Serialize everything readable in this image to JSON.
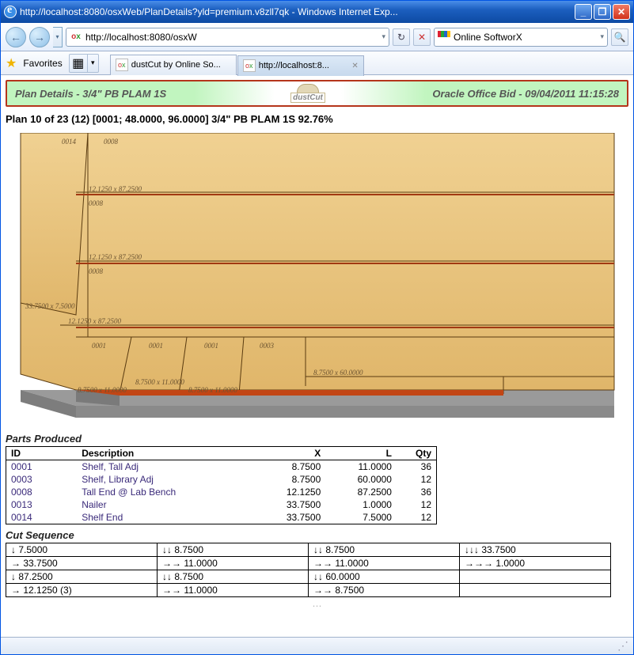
{
  "window": {
    "title": "http://localhost:8080/osxWeb/PlanDetails?yld=premium.v8zll7qk - Windows Internet Exp...",
    "buttons": {
      "min": "_",
      "max": "❐",
      "close": "✕"
    }
  },
  "nav": {
    "back_arrow": "←",
    "fwd_arrow": "→",
    "dropdown_arrow": "▾",
    "url": "http://localhost:8080/osxW",
    "refresh": "↻",
    "stop": "✕",
    "search_placeholder": "",
    "search_value": "Online SoftworX",
    "search_dropdown": "▾",
    "search_go": "🔍"
  },
  "favbar": {
    "label": "Favorites",
    "quick_dropdown": "▾"
  },
  "tabs": [
    {
      "label": "dustCut by Online So...",
      "active": false
    },
    {
      "label": "http://localhost:8...",
      "active": true
    }
  ],
  "header": {
    "left": "Plan Details - 3/4\" PB PLAM 1S",
    "logo": "dustCut",
    "right": "Oracle Office Bid - 09/04/2011 11:15:28"
  },
  "plan_summary": "Plan 10 of 23 (12) [0001; 48.0000, 96.0000] 3/4\" PB PLAM 1S 92.76%",
  "diagram": {
    "labels": {
      "topleft_id": "0014",
      "topright_id": "0008",
      "row2_id": "0008",
      "row3_id": "0008",
      "col_left_dim": "33.7500 x 7.5000",
      "row_dim_a": "12.1250 x 87.2500",
      "row_dim_b": "12.1250 x 87.2500",
      "row_dim_c": "12.1250 x 87.2500",
      "bot_ids": [
        "0001",
        "0001",
        "0001",
        "0003"
      ],
      "bot_dims_left": [
        "8.7500 x 11.0000",
        "8.7500 x 11.0000",
        "8.7500 x 11.0000"
      ],
      "bot_dim_right": "8.7500 x 60.0000"
    }
  },
  "parts_title": "Parts Produced",
  "parts_cols": {
    "id": "ID",
    "desc": "Description",
    "x": "X",
    "l": "L",
    "qty": "Qty"
  },
  "parts_rows": [
    {
      "id": "0001",
      "desc": "Shelf, Tall Adj",
      "x": "8.7500",
      "l": "11.0000",
      "qty": "36"
    },
    {
      "id": "0003",
      "desc": "Shelf, Library Adj",
      "x": "8.7500",
      "l": "60.0000",
      "qty": "12"
    },
    {
      "id": "0008",
      "desc": "Tall End @ Lab Bench",
      "x": "12.1250",
      "l": "87.2500",
      "qty": "36"
    },
    {
      "id": "0013",
      "desc": "Nailer",
      "x": "33.7500",
      "l": "1.0000",
      "qty": "12"
    },
    {
      "id": "0014",
      "desc": "Shelf End",
      "x": "33.7500",
      "l": "7.5000",
      "qty": "12"
    }
  ],
  "cutseq_title": "Cut Sequence",
  "cutseq": [
    [
      "↓ 7.5000",
      "↓↓ 8.7500",
      "↓↓ 8.7500",
      "↓↓↓ 33.7500"
    ],
    [
      "→ 33.7500",
      "→→ 11.0000",
      "→→ 11.0000",
      "→→→ 1.0000"
    ],
    [
      "↓ 87.2500",
      "↓↓ 8.7500",
      "↓↓ 60.0000",
      ""
    ],
    [
      "→ 12.1250 (3)",
      "→→ 11.0000",
      "→→ 8.7500",
      ""
    ]
  ]
}
